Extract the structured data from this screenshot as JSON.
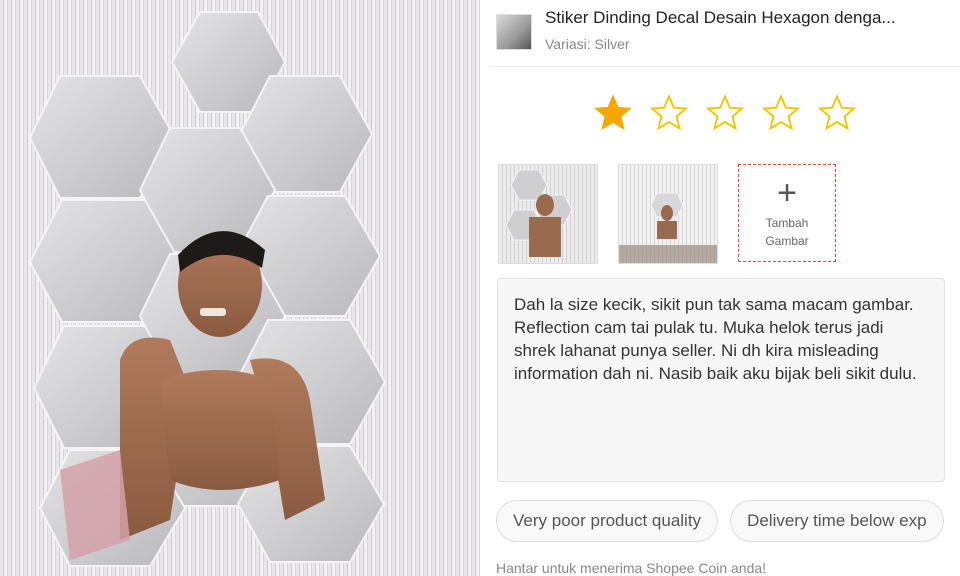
{
  "product": {
    "title": "Stiker Dinding Decal Desain Hexagon denga...",
    "variant": "Variasi: Silver"
  },
  "rating": {
    "value": 1,
    "max": 5,
    "filled_color": "#f6a700",
    "empty_color": "#f6c500"
  },
  "media": {
    "add_label_line1": "Tambah",
    "add_label_line2": "Gambar",
    "accent": "#ee4d2d"
  },
  "review": {
    "text": "Dah la size kecik, sikit pun tak sama macam gambar. Reflection cam tai pulak tu. Muka helok terus jadi shrek lahanat punya seller. Ni dh kira misleading information dah ni. Nasib baik aku bijak beli sikit dulu."
  },
  "tags": [
    "Very poor product quality",
    "Delivery time below exp"
  ],
  "footer": {
    "note": "Hantar untuk menerima Shopee Coin anda!"
  }
}
